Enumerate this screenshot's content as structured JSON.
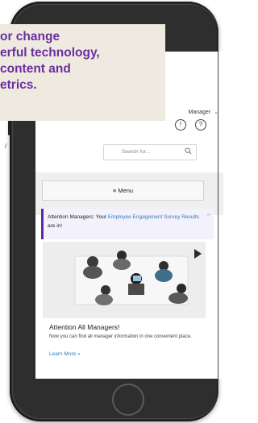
{
  "callout": {
    "lines": [
      "or change",
      "erful technology,",
      "content and",
      "etrics."
    ]
  },
  "header": {
    "user_label": "Manager",
    "caret_icon": "chevron-down-icon",
    "info_icon": "!",
    "help_icon": "?"
  },
  "search": {
    "placeholder": "Search for..."
  },
  "menu": {
    "label": "≡ Menu"
  },
  "alert": {
    "prefix": "Attention Managers: Your ",
    "link": "Employee Engagement Survey Results",
    "suffix": " are in!",
    "close": "×"
  },
  "card": {
    "title": "Attention All Managers!",
    "text": "Now you can find all manager information in one convenient place.",
    "link": "Learn More »"
  },
  "colors": {
    "accent_purple": "#6b2da0",
    "link_blue": "#2a7fc1",
    "callout_bg": "#efeae0"
  }
}
